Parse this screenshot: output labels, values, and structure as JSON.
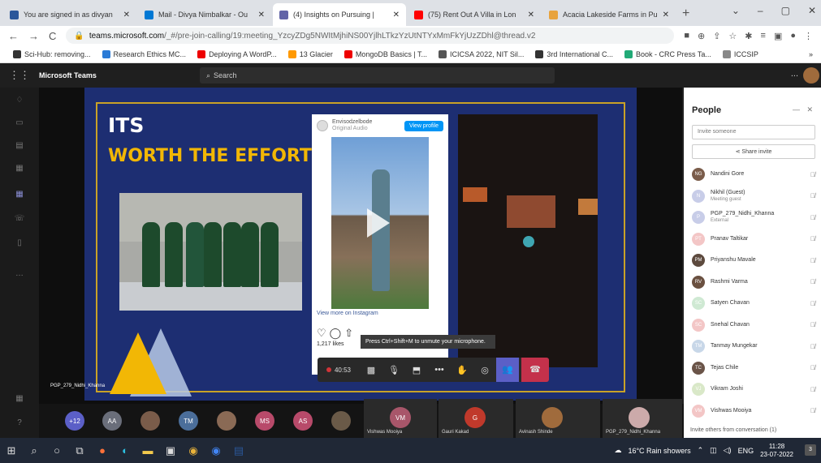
{
  "browser": {
    "tabs": [
      {
        "title": "You are signed in as divyan",
        "color": "#2b579a"
      },
      {
        "title": "Mail - Divya Nimbalkar - Ou",
        "color": "#0078d4"
      },
      {
        "title": "(4) Insights on Pursuing |",
        "color": "#6264a7",
        "active": true
      },
      {
        "title": "(75) Rent Out A Villa in Lon",
        "color": "#ff0000"
      },
      {
        "title": "Acacia Lakeside Farms in Pu",
        "color": "#e8a33d"
      }
    ],
    "new_tab": "+",
    "url_host": "teams.microsoft.com",
    "url_path": "/_#/pre-join-calling/19:meeting_YzcyZDg5NWItMjhiNS00YjlhLTkzYzUtNTYxMmFkYjUzZDhl@thread.v2",
    "bookmarks": [
      {
        "label": "Sci-Hub: removing...",
        "color": "#333"
      },
      {
        "label": "Research Ethics MC...",
        "color": "#2b7bd6"
      },
      {
        "label": "Deploying A WordP...",
        "color": "#e00"
      },
      {
        "label": "13 Glacier",
        "color": "#f90"
      },
      {
        "label": "MongoDB Basics | T...",
        "color": "#e00"
      },
      {
        "label": "ICICSA 2022, NIT Sil...",
        "color": "#555"
      },
      {
        "label": "3rd International C...",
        "color": "#333"
      },
      {
        "label": "Book - CRC Press Ta...",
        "color": "#2a7"
      },
      {
        "label": "ICCSIP",
        "color": "#888"
      }
    ],
    "bookmarks_more": "»"
  },
  "teams": {
    "app_name": "Microsoft Teams",
    "search_placeholder": "Search",
    "more": "..."
  },
  "slide": {
    "heading": "ITS",
    "subheading": "WORTH THE EFFORT!",
    "insta_account": "Envisodzelbode",
    "insta_sub": "Original Audio",
    "insta_view_profile": "View profile",
    "insta_more": "View more on Instagram",
    "insta_likes": "1,217 likes",
    "speaker_label": "PGP_279_Nidhi_Khanna"
  },
  "toast": "Press Ctrl+Shift+M to unmute your microphone.",
  "controls": {
    "timer": "40:53"
  },
  "people_panel": {
    "title": "People",
    "invite_placeholder": "Invite someone",
    "share_invite": "Share invite",
    "participants": [
      {
        "name": "Nandini Gore",
        "sub": "",
        "initials": "NG",
        "color": "#7a5c4a"
      },
      {
        "name": "Nikhil (Guest)",
        "sub": "Meeting guest",
        "initials": "N",
        "color": "#c8cde8"
      },
      {
        "name": "PGP_279_Nidhi_Khanna",
        "sub": "External",
        "initials": "P",
        "color": "#c8cde8"
      },
      {
        "name": "Pranav Taltikar",
        "sub": "",
        "initials": "PT",
        "color": "#f3c6c6"
      },
      {
        "name": "Priyanshu Mavale",
        "sub": "",
        "initials": "PM",
        "color": "#5d4a3e"
      },
      {
        "name": "Rashmi Varma",
        "sub": "",
        "initials": "RV",
        "color": "#6a5040"
      },
      {
        "name": "Satyen Chavan",
        "sub": "",
        "initials": "SC",
        "color": "#cfe9d3"
      },
      {
        "name": "Snehal Chavan",
        "sub": "",
        "initials": "SC",
        "color": "#f3c6c6"
      },
      {
        "name": "Tanmay Mungekar",
        "sub": "",
        "initials": "TM",
        "color": "#c8d7e8"
      },
      {
        "name": "Tejas Chile",
        "sub": "",
        "initials": "TC",
        "color": "#6a5448"
      },
      {
        "name": "Vikram Joshi",
        "sub": "",
        "initials": "VJ",
        "color": "#d9e8c8"
      },
      {
        "name": "Vishwas Mooiya",
        "sub": "",
        "initials": "VM",
        "color": "#f3c6c6"
      }
    ],
    "footer": "Invite others from conversation (1)"
  },
  "gallery": {
    "overflow": "+12",
    "avatars": [
      {
        "initials": "AA",
        "color": "#6a6e7a"
      },
      {
        "initials": "",
        "color": "#7a5c4a"
      },
      {
        "initials": "TM",
        "color": "#4b6e9a"
      },
      {
        "initials": "",
        "color": "#8a6a55"
      },
      {
        "initials": "MS",
        "color": "#b84a6a"
      },
      {
        "initials": "AS",
        "color": "#b84a6a"
      },
      {
        "initials": "",
        "color": "#6a5a48"
      }
    ],
    "tiles": [
      {
        "initials": "VM",
        "label": "Vishwas Mooiya",
        "color": "#a8566a"
      },
      {
        "initials": "G",
        "label": "Gauri Kakad",
        "color": "#c0392b"
      },
      {
        "initials": "",
        "label": "Avinash Shinde",
        "color": "#a06b3c"
      },
      {
        "initials": "",
        "label": "PGP_279_Nidhi_Khanna",
        "color": "#caa"
      }
    ]
  },
  "taskbar": {
    "weather": "16°C Rain showers",
    "lang": "ENG",
    "time": "11:28",
    "date": "23-07-2022",
    "notifications": "3"
  }
}
